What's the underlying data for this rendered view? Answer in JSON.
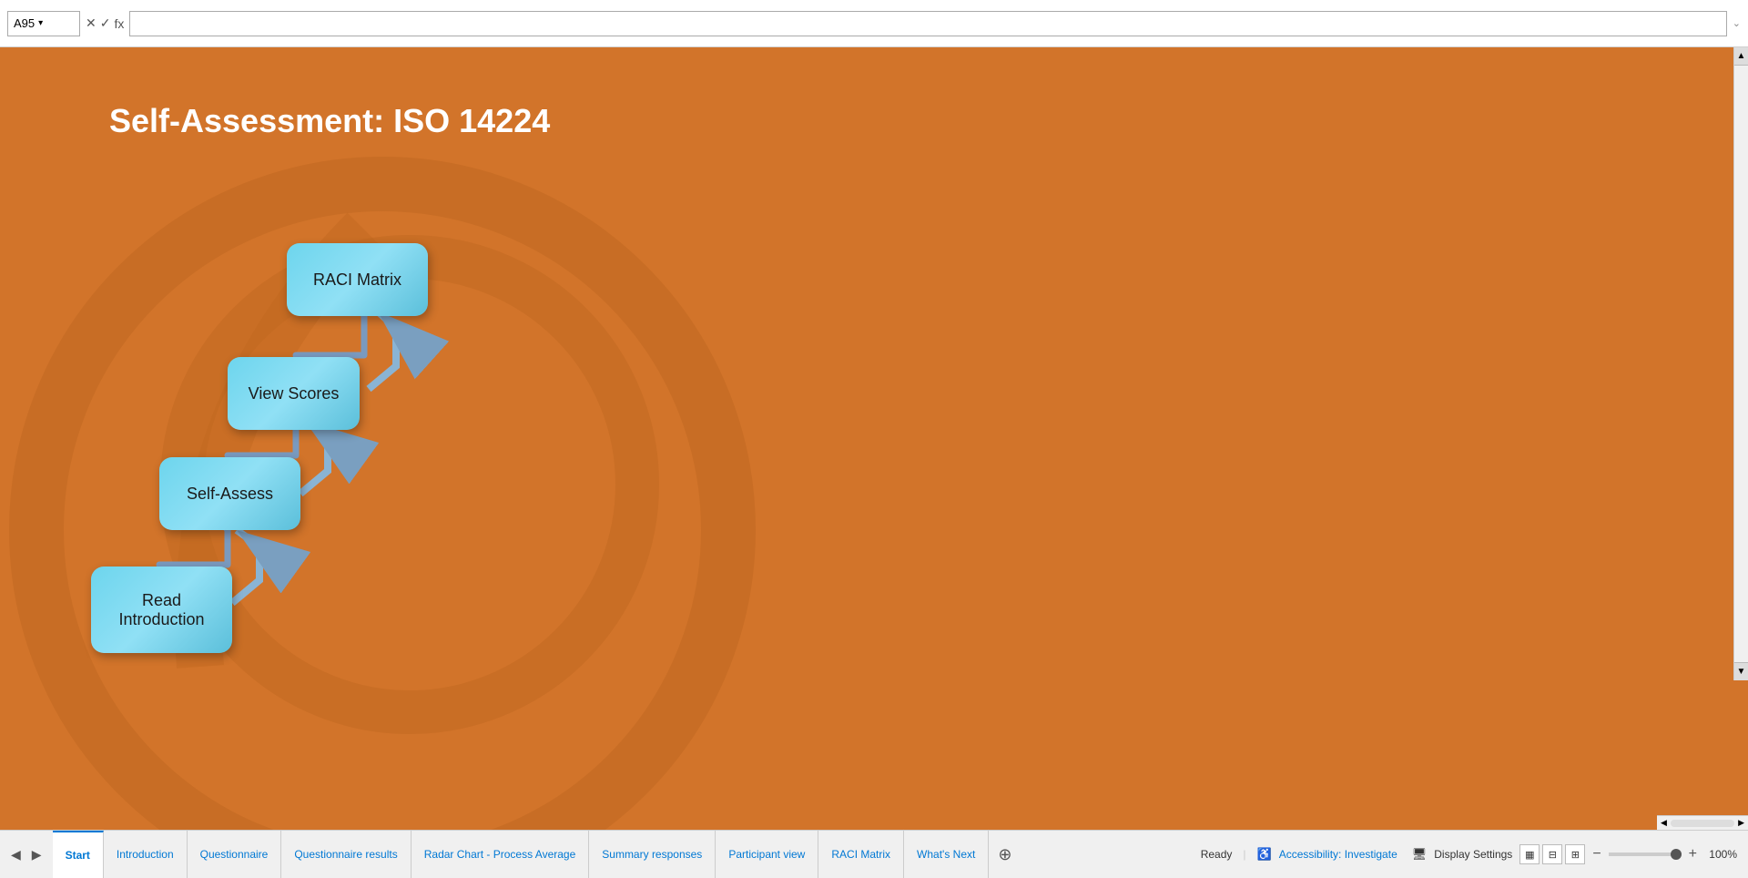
{
  "excel": {
    "cell_ref": "A95",
    "formula_bar_value": "",
    "dividers": [
      "✕",
      "✓",
      "fx"
    ]
  },
  "page": {
    "title": "Self-Assessment: ISO 14224",
    "background_color": "#d2742a"
  },
  "buttons": [
    {
      "id": "read-intro",
      "label": "Read\nIntroduction"
    },
    {
      "id": "self-assess",
      "label": "Self-Assess"
    },
    {
      "id": "view-scores",
      "label": "View Scores"
    },
    {
      "id": "raci-matrix",
      "label": "RACI Matrix"
    }
  ],
  "status_bar": {
    "ready_label": "Ready",
    "accessibility_label": "Accessibility: Investigate",
    "display_settings_label": "Display Settings",
    "zoom_label": "100%"
  },
  "sheet_tabs": [
    {
      "id": "start",
      "label": "Start",
      "active": true
    },
    {
      "id": "introduction",
      "label": "Introduction",
      "active": false
    },
    {
      "id": "questionnaire",
      "label": "Questionnaire",
      "active": false
    },
    {
      "id": "questionnaire-results",
      "label": "Questionnaire results",
      "active": false
    },
    {
      "id": "radar-chart",
      "label": "Radar Chart - Process Average",
      "active": false
    },
    {
      "id": "summary-responses",
      "label": "Summary responses",
      "active": false
    },
    {
      "id": "participant-view",
      "label": "Participant view",
      "active": false
    },
    {
      "id": "raci-matrix-tab",
      "label": "RACI Matrix",
      "active": false
    },
    {
      "id": "whats-next",
      "label": "What's Next",
      "active": false
    }
  ]
}
